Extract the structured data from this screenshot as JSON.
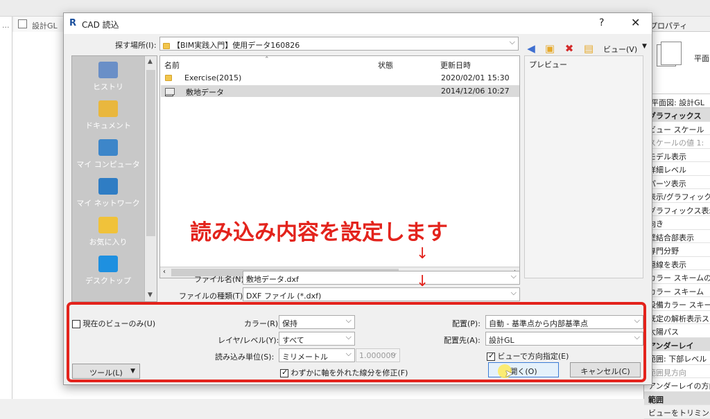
{
  "background": {
    "left_menu": "...",
    "view_tab": "設計GL",
    "properties": {
      "title": "プロパティ",
      "preview_label": "平面",
      "selector": "平面図: 設計GL",
      "rows": [
        {
          "text": "グラフィックス",
          "group": true
        },
        {
          "text": "ビュー スケール"
        },
        {
          "text": "スケールの値  1:",
          "dim": true
        },
        {
          "text": "モデル表示"
        },
        {
          "text": "詳細レベル"
        },
        {
          "text": "パーツ表示"
        },
        {
          "text": "表示/グラフィックス"
        },
        {
          "text": "グラフィックス表示オ"
        },
        {
          "text": "向き"
        },
        {
          "text": "壁結合部表示"
        },
        {
          "text": "専門分野"
        },
        {
          "text": "隠線を表示"
        },
        {
          "text": "カラー スキームの場所"
        },
        {
          "text": "カラー スキーム"
        },
        {
          "text": "設備カラー スキーム"
        },
        {
          "text": "既定の解析表示ス"
        },
        {
          "text": "太陽パス"
        },
        {
          "text": "アンダーレイ",
          "group": true
        },
        {
          "text": "範囲: 下部レベル"
        },
        {
          "text": "範囲見方向",
          "dim": true
        },
        {
          "text": "アンダーレイの方向"
        },
        {
          "text": "範囲",
          "group": true
        },
        {
          "text": "ビューをトリミング"
        }
      ]
    }
  },
  "dialog": {
    "logo": "R",
    "title": "CAD 読込",
    "help": "?",
    "close": "✕",
    "look_in_label": "探す場所(I):",
    "look_in_value": "【BIM実践入門】使用データ160826",
    "view_menu": "ビュー(V)",
    "places": [
      {
        "label": "ヒストリ",
        "color": "#6a8fc7"
      },
      {
        "label": "ドキュメント",
        "color": "#e9b73e"
      },
      {
        "label": "マイ コンピュータ",
        "color": "#3d86c9"
      },
      {
        "label": "マイ ネットワーク",
        "color": "#2f7dc4"
      },
      {
        "label": "お気に入り",
        "color": "#f0c23a"
      },
      {
        "label": "デスクトップ",
        "color": "#1e90e0"
      }
    ],
    "columns": {
      "name": "名前",
      "status": "状態",
      "modified": "更新日時"
    },
    "files": [
      {
        "name": "Exercise(2015)",
        "status": "",
        "modified": "2020/02/01 15:30",
        "type": "folder",
        "selected": false
      },
      {
        "name": "敷地データ",
        "status": "",
        "modified": "2014/12/06 10:27",
        "type": "dxf",
        "selected": true
      }
    ],
    "preview_label": "プレビュー",
    "file_name_label": "ファイル名(N):",
    "file_name_value": "敷地データ.dxf",
    "file_type_label": "ファイルの種類(T):",
    "file_type_value": "DXF ファイル (*.dxf)",
    "current_view_only": "現在のビューのみ(U)",
    "color_label": "カラー(R):",
    "color_value": "保持",
    "layers_label": "レイヤ/レベル(Y):",
    "layers_value": "すべて",
    "units_label": "読み込み単位(S):",
    "units_value": "ミリメートル",
    "units_factor": "1.000000",
    "correct_lines": "わずかに軸を外れた線分を修正(F)",
    "positioning_label": "配置(P):",
    "positioning_value": "自動 - 基準点から内部基準点",
    "place_at_label": "配置先(A):",
    "place_at_value": "設計GL",
    "orient_to_view": "ビューで方向指定(E)",
    "tools_button": "ツール(L)",
    "open_button": "開く(O)",
    "cancel_button": "キャンセル(C)"
  },
  "annotation": {
    "text": "読み込み内容を設定します",
    "arrow": "↓",
    "color": "#e3231c"
  }
}
